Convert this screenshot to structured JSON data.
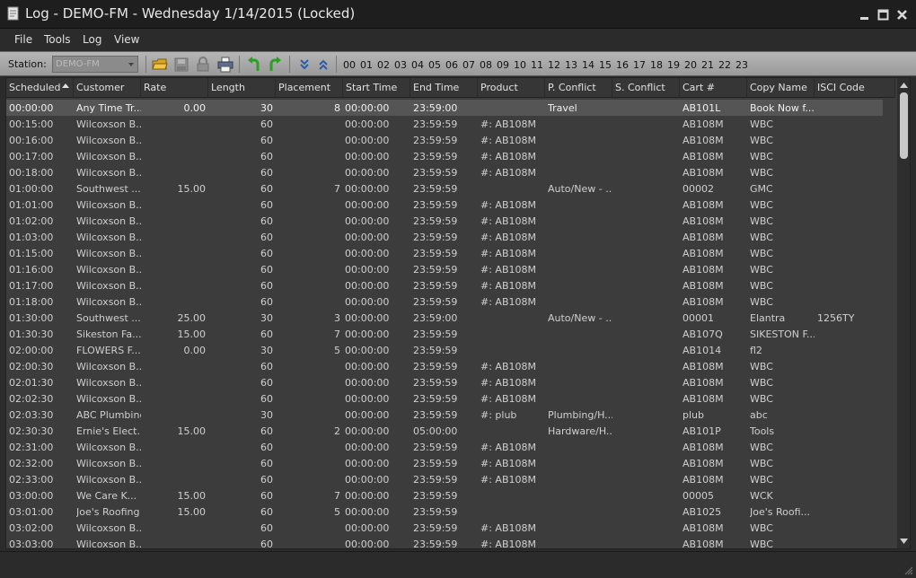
{
  "window": {
    "title": "Log - DEMO-FM - Wednesday 1/14/2015 (Locked)"
  },
  "menu": [
    "File",
    "Tools",
    "Log",
    "View"
  ],
  "toolbar": {
    "station_label": "Station:",
    "station_value": "DEMO-FM",
    "hours": [
      "00",
      "01",
      "02",
      "03",
      "04",
      "05",
      "06",
      "07",
      "08",
      "09",
      "10",
      "11",
      "12",
      "13",
      "14",
      "15",
      "16",
      "17",
      "18",
      "19",
      "20",
      "21",
      "22",
      "23"
    ]
  },
  "columns": [
    "Scheduled",
    "Customer",
    "Rate",
    "Length",
    "Placement",
    "Start Time",
    "End Time",
    "Product",
    "P. Conflict",
    "S. Conflict",
    "Cart #",
    "Copy Name",
    "ISCI Code"
  ],
  "rows": [
    {
      "scheduled": "00:00:00",
      "customer": "Any Time Tr...",
      "rate": "0.00",
      "length": "30",
      "placement": "8",
      "start": "00:00:00",
      "end": "23:59:00",
      "product": "",
      "pconflict": "Travel",
      "sconflict": "",
      "cart": "AB101L",
      "copy": "Book Now f...",
      "isci": "",
      "selected": true
    },
    {
      "scheduled": "00:15:00",
      "customer": "Wilcoxson B...",
      "rate": "",
      "length": "60",
      "placement": "",
      "start": "00:00:00",
      "end": "23:59:59",
      "product": "#: AB108M",
      "pconflict": "",
      "sconflict": "",
      "cart": "AB108M",
      "copy": "WBC",
      "isci": ""
    },
    {
      "scheduled": "00:16:00",
      "customer": "Wilcoxson B...",
      "rate": "",
      "length": "60",
      "placement": "",
      "start": "00:00:00",
      "end": "23:59:59",
      "product": "#: AB108M",
      "pconflict": "",
      "sconflict": "",
      "cart": "AB108M",
      "copy": "WBC",
      "isci": ""
    },
    {
      "scheduled": "00:17:00",
      "customer": "Wilcoxson B...",
      "rate": "",
      "length": "60",
      "placement": "",
      "start": "00:00:00",
      "end": "23:59:59",
      "product": "#: AB108M",
      "pconflict": "",
      "sconflict": "",
      "cart": "AB108M",
      "copy": "WBC",
      "isci": ""
    },
    {
      "scheduled": "00:18:00",
      "customer": "Wilcoxson B...",
      "rate": "",
      "length": "60",
      "placement": "",
      "start": "00:00:00",
      "end": "23:59:59",
      "product": "#: AB108M",
      "pconflict": "",
      "sconflict": "",
      "cart": "AB108M",
      "copy": "WBC",
      "isci": ""
    },
    {
      "scheduled": "01:00:00",
      "customer": "Southwest ...",
      "rate": "15.00",
      "length": "60",
      "placement": "7",
      "start": "00:00:00",
      "end": "23:59:59",
      "product": "",
      "pconflict": "Auto/New - ...",
      "sconflict": "",
      "cart": "00002",
      "copy": "GMC",
      "isci": ""
    },
    {
      "scheduled": "01:01:00",
      "customer": "Wilcoxson B...",
      "rate": "",
      "length": "60",
      "placement": "",
      "start": "00:00:00",
      "end": "23:59:59",
      "product": "#: AB108M",
      "pconflict": "",
      "sconflict": "",
      "cart": "AB108M",
      "copy": "WBC",
      "isci": ""
    },
    {
      "scheduled": "01:02:00",
      "customer": "Wilcoxson B...",
      "rate": "",
      "length": "60",
      "placement": "",
      "start": "00:00:00",
      "end": "23:59:59",
      "product": "#: AB108M",
      "pconflict": "",
      "sconflict": "",
      "cart": "AB108M",
      "copy": "WBC",
      "isci": ""
    },
    {
      "scheduled": "01:03:00",
      "customer": "Wilcoxson B...",
      "rate": "",
      "length": "60",
      "placement": "",
      "start": "00:00:00",
      "end": "23:59:59",
      "product": "#: AB108M",
      "pconflict": "",
      "sconflict": "",
      "cart": "AB108M",
      "copy": "WBC",
      "isci": ""
    },
    {
      "scheduled": "01:15:00",
      "customer": "Wilcoxson B...",
      "rate": "",
      "length": "60",
      "placement": "",
      "start": "00:00:00",
      "end": "23:59:59",
      "product": "#: AB108M",
      "pconflict": "",
      "sconflict": "",
      "cart": "AB108M",
      "copy": "WBC",
      "isci": ""
    },
    {
      "scheduled": "01:16:00",
      "customer": "Wilcoxson B...",
      "rate": "",
      "length": "60",
      "placement": "",
      "start": "00:00:00",
      "end": "23:59:59",
      "product": "#: AB108M",
      "pconflict": "",
      "sconflict": "",
      "cart": "AB108M",
      "copy": "WBC",
      "isci": ""
    },
    {
      "scheduled": "01:17:00",
      "customer": "Wilcoxson B...",
      "rate": "",
      "length": "60",
      "placement": "",
      "start": "00:00:00",
      "end": "23:59:59",
      "product": "#: AB108M",
      "pconflict": "",
      "sconflict": "",
      "cart": "AB108M",
      "copy": "WBC",
      "isci": ""
    },
    {
      "scheduled": "01:18:00",
      "customer": "Wilcoxson B...",
      "rate": "",
      "length": "60",
      "placement": "",
      "start": "00:00:00",
      "end": "23:59:59",
      "product": "#: AB108M",
      "pconflict": "",
      "sconflict": "",
      "cart": "AB108M",
      "copy": "WBC",
      "isci": ""
    },
    {
      "scheduled": "01:30:00",
      "customer": "Southwest ...",
      "rate": "25.00",
      "length": "30",
      "placement": "3",
      "start": "00:00:00",
      "end": "23:59:00",
      "product": "",
      "pconflict": "Auto/New - ...",
      "sconflict": "",
      "cart": "00001",
      "copy": "Elantra",
      "isci": "1256TY"
    },
    {
      "scheduled": "01:30:30",
      "customer": "Sikeston Fa...",
      "rate": "15.00",
      "length": "60",
      "placement": "7",
      "start": "00:00:00",
      "end": "23:59:59",
      "product": "",
      "pconflict": "",
      "sconflict": "",
      "cart": "AB107Q",
      "copy": "SIKESTON F...",
      "isci": ""
    },
    {
      "scheduled": "02:00:00",
      "customer": "FLOWERS F...",
      "rate": "0.00",
      "length": "30",
      "placement": "5",
      "start": "00:00:00",
      "end": "23:59:59",
      "product": "",
      "pconflict": "",
      "sconflict": "",
      "cart": "AB1014",
      "copy": "fl2",
      "isci": ""
    },
    {
      "scheduled": "02:00:30",
      "customer": "Wilcoxson B...",
      "rate": "",
      "length": "60",
      "placement": "",
      "start": "00:00:00",
      "end": "23:59:59",
      "product": "#: AB108M",
      "pconflict": "",
      "sconflict": "",
      "cart": "AB108M",
      "copy": "WBC",
      "isci": ""
    },
    {
      "scheduled": "02:01:30",
      "customer": "Wilcoxson B...",
      "rate": "",
      "length": "60",
      "placement": "",
      "start": "00:00:00",
      "end": "23:59:59",
      "product": "#: AB108M",
      "pconflict": "",
      "sconflict": "",
      "cart": "AB108M",
      "copy": "WBC",
      "isci": ""
    },
    {
      "scheduled": "02:02:30",
      "customer": "Wilcoxson B...",
      "rate": "",
      "length": "60",
      "placement": "",
      "start": "00:00:00",
      "end": "23:59:59",
      "product": "#: AB108M",
      "pconflict": "",
      "sconflict": "",
      "cart": "AB108M",
      "copy": "WBC",
      "isci": ""
    },
    {
      "scheduled": "02:03:30",
      "customer": "ABC Plumbing",
      "rate": "",
      "length": "30",
      "placement": "",
      "start": "00:00:00",
      "end": "23:59:59",
      "product": "#: plub",
      "pconflict": "Plumbing/H...",
      "sconflict": "",
      "cart": "plub",
      "copy": "abc",
      "isci": ""
    },
    {
      "scheduled": "02:30:30",
      "customer": "Ernie's Elect...",
      "rate": "15.00",
      "length": "60",
      "placement": "2",
      "start": "00:00:00",
      "end": "05:00:00",
      "product": "",
      "pconflict": "Hardware/H...",
      "sconflict": "",
      "cart": "AB101P",
      "copy": "Tools",
      "isci": ""
    },
    {
      "scheduled": "02:31:00",
      "customer": "Wilcoxson B...",
      "rate": "",
      "length": "60",
      "placement": "",
      "start": "00:00:00",
      "end": "23:59:59",
      "product": "#: AB108M",
      "pconflict": "",
      "sconflict": "",
      "cart": "AB108M",
      "copy": "WBC",
      "isci": ""
    },
    {
      "scheduled": "02:32:00",
      "customer": "Wilcoxson B...",
      "rate": "",
      "length": "60",
      "placement": "",
      "start": "00:00:00",
      "end": "23:59:59",
      "product": "#: AB108M",
      "pconflict": "",
      "sconflict": "",
      "cart": "AB108M",
      "copy": "WBC",
      "isci": ""
    },
    {
      "scheduled": "02:33:00",
      "customer": "Wilcoxson B...",
      "rate": "",
      "length": "60",
      "placement": "",
      "start": "00:00:00",
      "end": "23:59:59",
      "product": "#: AB108M",
      "pconflict": "",
      "sconflict": "",
      "cart": "AB108M",
      "copy": "WBC",
      "isci": ""
    },
    {
      "scheduled": "03:00:00",
      "customer": "We Care  K...",
      "rate": "15.00",
      "length": "60",
      "placement": "7",
      "start": "00:00:00",
      "end": "23:59:59",
      "product": "",
      "pconflict": "",
      "sconflict": "",
      "cart": "00005",
      "copy": "WCK",
      "isci": ""
    },
    {
      "scheduled": "03:01:00",
      "customer": "Joe's Roofing",
      "rate": "15.00",
      "length": "60",
      "placement": "5",
      "start": "00:00:00",
      "end": "23:59:59",
      "product": "",
      "pconflict": "",
      "sconflict": "",
      "cart": "AB1025",
      "copy": "Joe's Roofi...",
      "isci": ""
    },
    {
      "scheduled": "03:02:00",
      "customer": "Wilcoxson B...",
      "rate": "",
      "length": "60",
      "placement": "",
      "start": "00:00:00",
      "end": "23:59:59",
      "product": "#: AB108M",
      "pconflict": "",
      "sconflict": "",
      "cart": "AB108M",
      "copy": "WBC",
      "isci": ""
    },
    {
      "scheduled": "03:03:00",
      "customer": "Wilcoxson B...",
      "rate": "",
      "length": "60",
      "placement": "",
      "start": "00:00:00",
      "end": "23:59:59",
      "product": "#: AB108M",
      "pconflict": "",
      "sconflict": "",
      "cart": "AB108M",
      "copy": "WBC",
      "isci": ""
    }
  ]
}
